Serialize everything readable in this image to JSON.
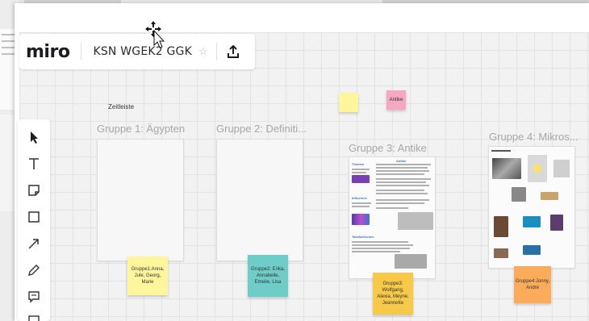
{
  "app": {
    "logo": "miro",
    "board_title": "KSN WGEK2 GGK",
    "star_glyph": "☆"
  },
  "canvas": {
    "timeline_label": "Zeitleiste",
    "frames": [
      {
        "title": "Gruppe 1: Ägypten"
      },
      {
        "title": "Gruppe 2: Definiti..."
      },
      {
        "title": "Gruppe 3: Antike"
      },
      {
        "title": "Gruppe 4: Mikros..."
      }
    ],
    "stickies": [
      {
        "text": "Gruppe1:Anna, Jule, Georg, Marie",
        "color": "#fff59d"
      },
      {
        "text": "Gruppe2: Erika, Annabelle, Emelie, Lisa",
        "color": "#6fcdc9"
      },
      {
        "text": "Gruppe3: Wolfgang, Alexia, Meyne, Jeannette",
        "color": "#f7c948"
      },
      {
        "text": "Gruppe4:Jonny, Andre",
        "color": "#fbac5b"
      },
      {
        "text": "",
        "color": "#fff59d"
      },
      {
        "text": "Antike",
        "color": "#f6a7c1"
      }
    ],
    "frame3": {
      "headings": [
        "Themen",
        "Antike",
        "Influencer",
        "Tabellarisches"
      ]
    }
  },
  "toolbar": {
    "tools": [
      "select-icon",
      "text-icon",
      "sticky-note-icon",
      "shape-icon",
      "connection-line-icon",
      "pen-icon",
      "comment-icon",
      "frame-icon"
    ]
  },
  "colors": {
    "canvas_bg": "#f2f2f2",
    "accent_blue": "#3a74c9"
  }
}
